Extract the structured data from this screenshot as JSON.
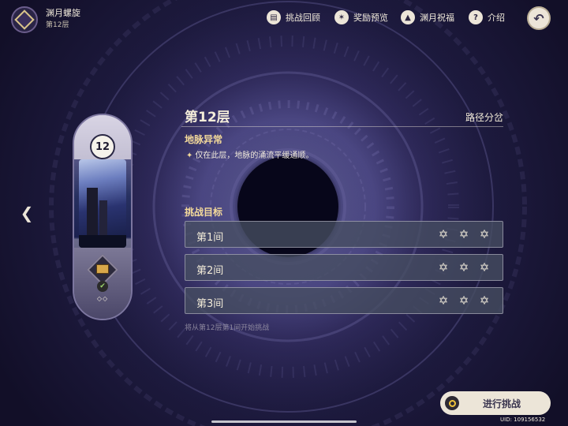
{
  "header": {
    "title": "渊月螺旋",
    "subtitle": "第12层",
    "nav": [
      {
        "label": "挑战回顾",
        "icon": "book-icon"
      },
      {
        "label": "奖励预览",
        "icon": "star-badge-icon"
      },
      {
        "label": "渊月祝福",
        "icon": "up-arrow-icon"
      },
      {
        "label": "介绍",
        "icon": "question-icon"
      }
    ],
    "back_icon": "return-icon"
  },
  "floor_card": {
    "number": "12",
    "pips": "◇◇"
  },
  "panel": {
    "floor_title": "第12层",
    "path_label": "路径分岔",
    "ley_title": "地脉异常",
    "ley_desc": "仅在此层，地脉的涌流平缓通顺。",
    "goal_title": "挑战目标",
    "chambers": [
      {
        "name": "第1间",
        "stars": 3
      },
      {
        "name": "第2间",
        "stars": 3
      },
      {
        "name": "第3间",
        "stars": 3
      }
    ],
    "hint": "将从第12层第1间开始挑战"
  },
  "start_button": {
    "label": "进行挑战"
  },
  "uid": "UID: 109156532",
  "colors": {
    "accent_gold": "#f3d99a",
    "panel_row": "#464e62",
    "button_bg": "#ece5d8"
  }
}
